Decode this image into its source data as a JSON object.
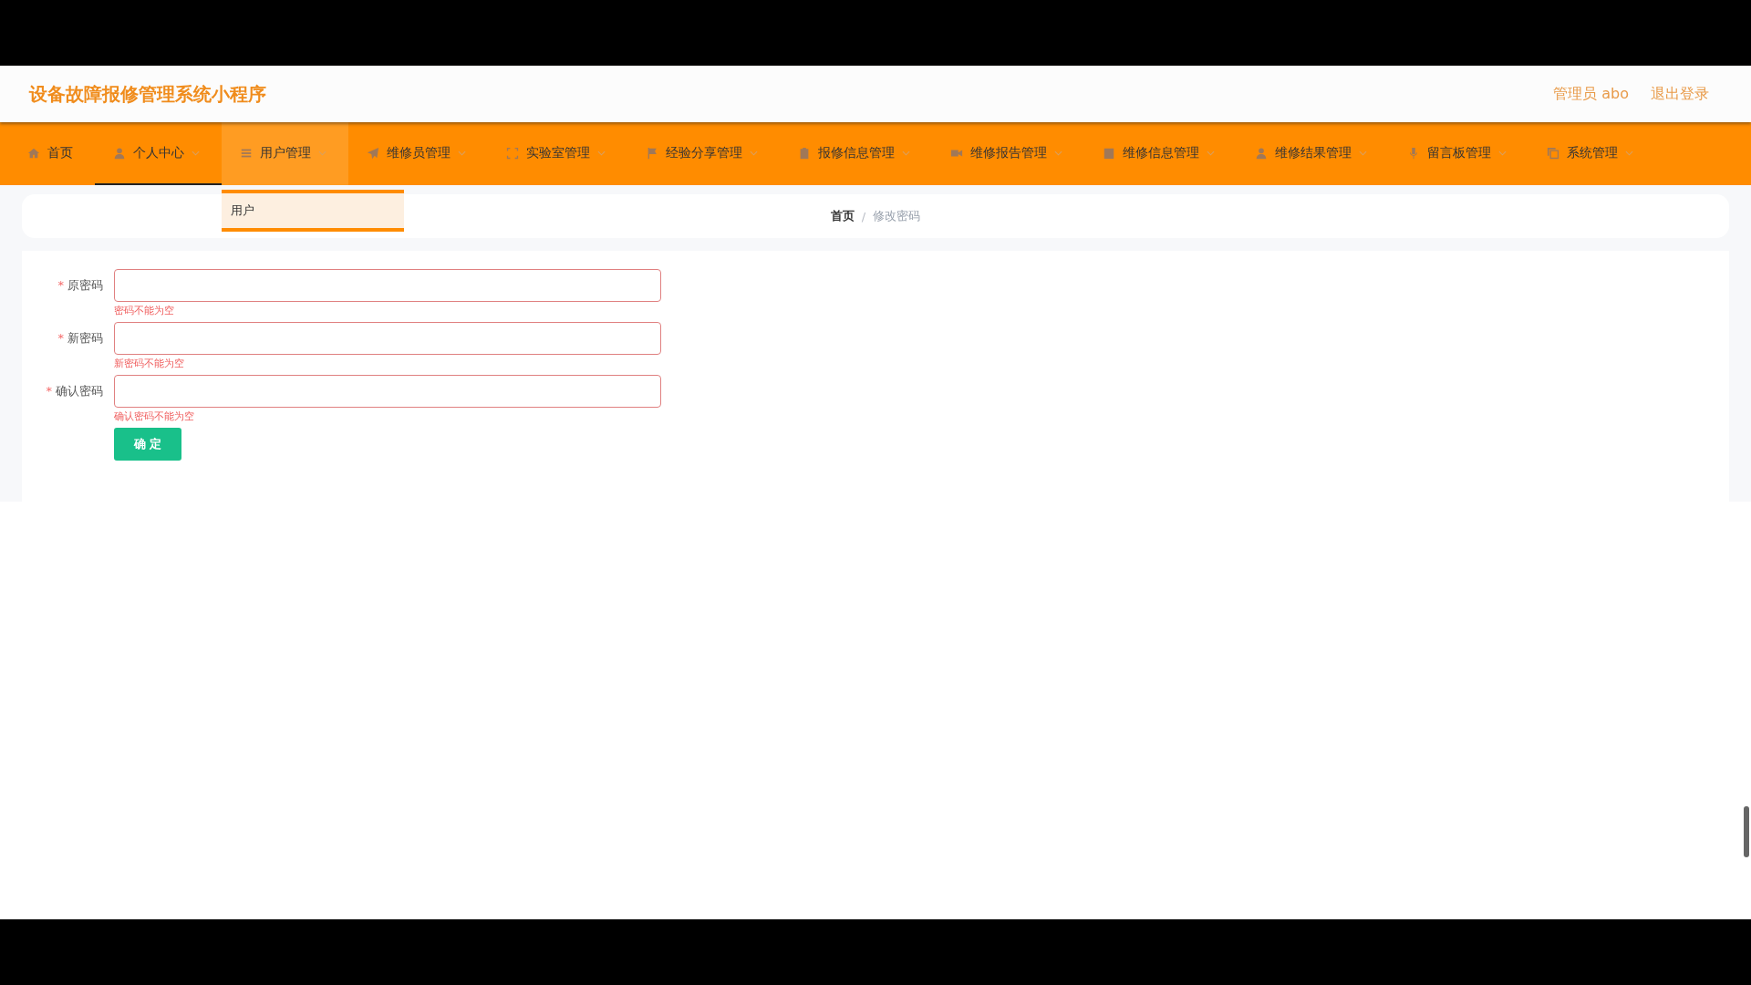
{
  "header": {
    "title": "设备故障报修管理系统小程序",
    "user": "管理员 abo",
    "logout": "退出登录"
  },
  "nav": {
    "items": [
      {
        "label": "首页",
        "has_caret": false,
        "selected": false,
        "expanded": false
      },
      {
        "label": "个人中心",
        "has_caret": true,
        "selected": true,
        "expanded": false
      },
      {
        "label": "用户管理",
        "has_caret": true,
        "selected": false,
        "expanded": true,
        "submenu": [
          {
            "label": "用户"
          }
        ]
      },
      {
        "label": "维修员管理",
        "has_caret": true,
        "selected": false,
        "expanded": false
      },
      {
        "label": "实验室管理",
        "has_caret": true,
        "selected": false,
        "expanded": false
      },
      {
        "label": "经验分享管理",
        "has_caret": true,
        "selected": false,
        "expanded": false
      },
      {
        "label": "报修信息管理",
        "has_caret": true,
        "selected": false,
        "expanded": false
      },
      {
        "label": "维修报告管理",
        "has_caret": true,
        "selected": false,
        "expanded": false
      },
      {
        "label": "维修信息管理",
        "has_caret": true,
        "selected": false,
        "expanded": false
      },
      {
        "label": "维修结果管理",
        "has_caret": true,
        "selected": false,
        "expanded": false
      },
      {
        "label": "留言板管理",
        "has_caret": true,
        "selected": false,
        "expanded": false
      },
      {
        "label": "系统管理",
        "has_caret": true,
        "selected": false,
        "expanded": false
      }
    ]
  },
  "breadcrumb": {
    "items": [
      "首页",
      "修改密码"
    ],
    "separator": "/"
  },
  "form": {
    "required_mark": "*",
    "fields": [
      {
        "label": "原密码",
        "required": true,
        "error": "密码不能为空"
      },
      {
        "label": "新密码",
        "required": true,
        "error": "新密码不能为空"
      },
      {
        "label": "确认密码",
        "required": true,
        "error": "确认密码不能为空"
      }
    ],
    "submit": "确 定"
  }
}
